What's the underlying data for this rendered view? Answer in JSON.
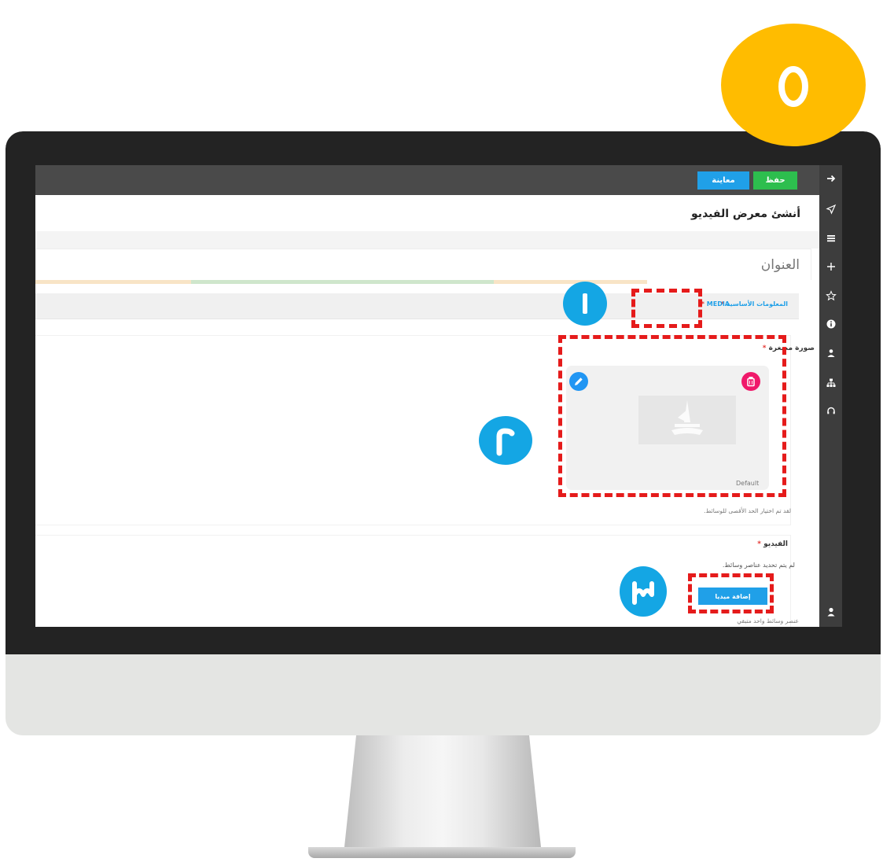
{
  "steps": {
    "main": "٥",
    "tab_callout": "١",
    "thumbnail_callout": "٢",
    "add_media_callout": "٣"
  },
  "toolbar": {
    "save_label": "حفظ",
    "preview_label": "معاينة"
  },
  "page": {
    "title": "أنشئ معرض الفيديو"
  },
  "form": {
    "title_placeholder": "العنوان"
  },
  "tabs": [
    {
      "label": "المعلومات الأساسية",
      "required": "*"
    },
    {
      "label": "MEDIA",
      "required": "*"
    }
  ],
  "thumbnail": {
    "label": "صورة مصغرة",
    "required": "*",
    "default_label": "Default",
    "max_note": "لقد تم اختيار الحد الأقصى للوسائط."
  },
  "video": {
    "label": "الفيديو",
    "required": "*",
    "no_items": "لم يتم تحديد عناصر وسائط.",
    "add_button": "إضافة ميديا",
    "one_item_note": "عنصر وسائط واحد متبقي"
  },
  "sidebar_icons": [
    "arrow-right-icon",
    "send-icon",
    "menu-icon",
    "plus-icon",
    "star-icon",
    "info-icon",
    "users-icon",
    "sitemap-icon",
    "headset-icon",
    "user-icon"
  ],
  "colors": {
    "step_main": "#ffbc00",
    "callout": "#14a6e4",
    "highlight": "#e51b1b",
    "save": "#2dbe4e",
    "preview": "#20a0e8",
    "delete": "#f0196a"
  }
}
